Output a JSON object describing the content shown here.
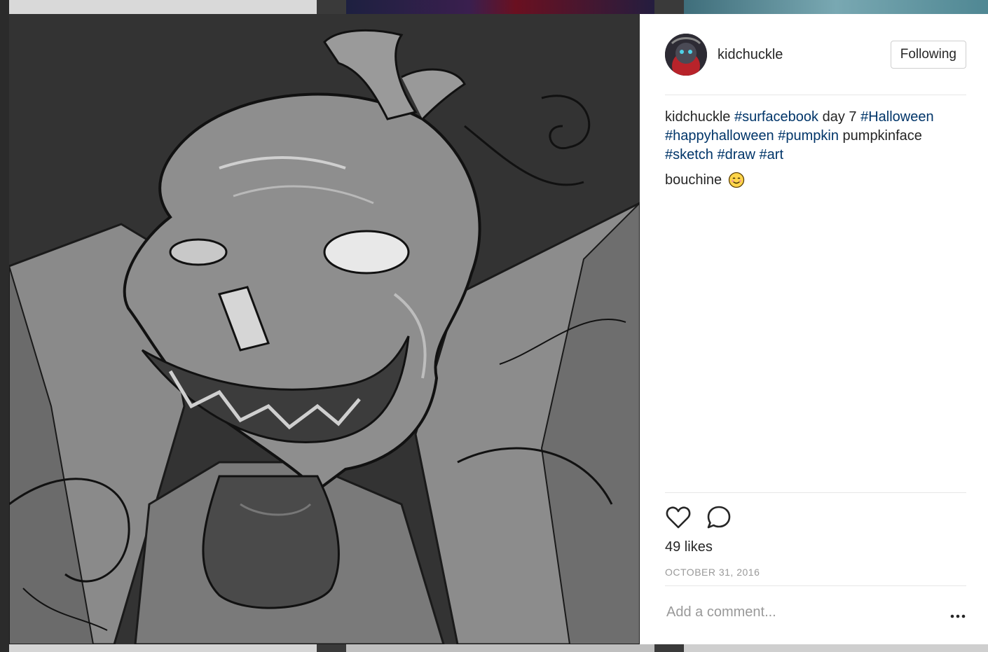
{
  "post": {
    "username": "kidchuckle",
    "follow_label": "Following",
    "caption": {
      "user": "kidchuckle",
      "parts": [
        {
          "type": "tag",
          "text": "#surfacebook"
        },
        {
          "type": "text",
          "text": "day 7"
        },
        {
          "type": "tag",
          "text": "#Halloween"
        },
        {
          "type": "tag",
          "text": "#happyhalloween"
        },
        {
          "type": "tag",
          "text": "#pumpkin"
        },
        {
          "type": "text",
          "text": "pumpkinface"
        },
        {
          "type": "tag",
          "text": "#sketch"
        },
        {
          "type": "tag",
          "text": "#draw"
        },
        {
          "type": "tag",
          "text": "#art"
        }
      ]
    },
    "comment": {
      "text": "bouchine",
      "emoji": "smiling-face-emoji"
    },
    "likes": "49 likes",
    "date": "OCTOBER 31, 2016",
    "add_comment_placeholder": "Add a comment..."
  },
  "icons": {
    "like": "heart-icon",
    "comment": "comment-bubble-icon",
    "more": "more-options-icon"
  },
  "colors": {
    "hashtag": "#003569",
    "text": "#262626",
    "muted": "#999999",
    "backdrop": "#3a3a3a",
    "image_bg": "#333333"
  }
}
